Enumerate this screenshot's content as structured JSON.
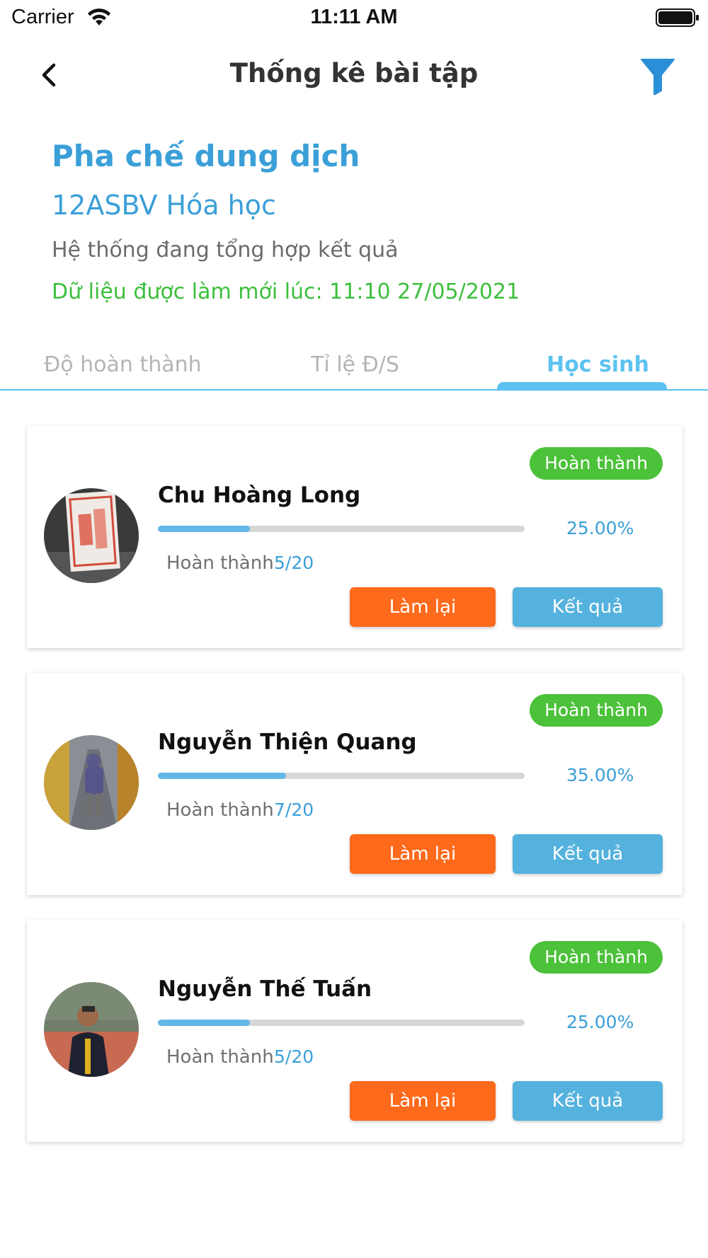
{
  "status_bar": {
    "carrier": "Carrier",
    "time": "11:11 AM"
  },
  "nav": {
    "title": "Thống kê bài tập",
    "back_icon": "chevron-left-icon",
    "filter_icon": "filter-icon"
  },
  "header": {
    "assignment_title": "Pha chế dung dịch",
    "class_name": "12ASBV Hóa học",
    "system_status": "Hệ thống đang tổng hợp kết quả",
    "refresh_text": "Dữ liệu được làm mới lúc: 11:10 27/05/2021"
  },
  "tabs": [
    {
      "label": "Độ hoàn thành",
      "active": false
    },
    {
      "label": "Tỉ lệ Đ/S",
      "active": false
    },
    {
      "label": "Học sinh",
      "active": true
    }
  ],
  "students": [
    {
      "name": "Chu Hoàng Long",
      "status": "Hoàn thành",
      "progress": 0.25,
      "percent": "25.00%",
      "done_label": "Hoàn thành",
      "done_count": "5/20",
      "redo_label": "Làm lại",
      "result_label": "Kết quả"
    },
    {
      "name": "Nguyễn Thiện Quang",
      "status": "Hoàn thành",
      "progress": 0.35,
      "percent": "35.00%",
      "done_label": "Hoàn thành",
      "done_count": "7/20",
      "redo_label": "Làm lại",
      "result_label": "Kết quả"
    },
    {
      "name": "Nguyễn Thế Tuấn",
      "status": "Hoàn thành",
      "progress": 0.25,
      "percent": "25.00%",
      "done_label": "Hoàn thành",
      "done_count": "5/20",
      "redo_label": "Làm lại",
      "result_label": "Kết quả"
    }
  ],
  "colors": {
    "accent": "#3b9fd8",
    "tab_active": "#5cc2ef",
    "badge_green": "#4cc13a",
    "refresh_green": "#3cbf3c",
    "redo_orange": "#fd6a1b",
    "result_blue": "#55b2de"
  }
}
